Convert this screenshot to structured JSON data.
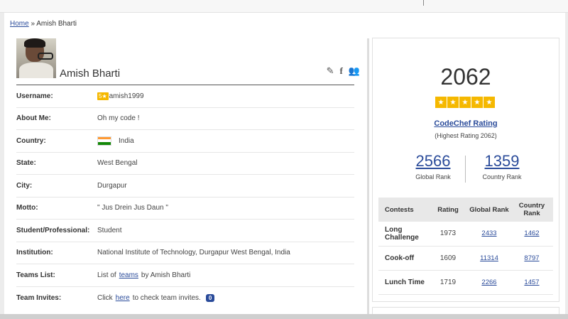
{
  "breadcrumb": {
    "home": "Home",
    "separator": "»",
    "current": "Amish Bharti"
  },
  "profile": {
    "name": "Amish Bharti",
    "actions": [
      {
        "icon": "pencil-icon",
        "glyph": "✎"
      },
      {
        "icon": "facebook-icon",
        "glyph": "f"
      },
      {
        "icon": "users-icon",
        "glyph": "👥"
      }
    ],
    "rows": [
      {
        "label": "Username:",
        "value": "amish1999",
        "badge": "5★"
      },
      {
        "label": "About Me:",
        "value": "Oh my code !"
      },
      {
        "label": "Country:",
        "value": "India"
      },
      {
        "label": "State:",
        "value": "West Bengal"
      },
      {
        "label": "City:",
        "value": "Durgapur"
      },
      {
        "label": "Motto:",
        "value": "\" Jus Drein Jus Daun \""
      },
      {
        "label": "Student/Professional:",
        "value": "Student"
      },
      {
        "label": "Institution:",
        "value": "National Institute of Technology, Durgapur West Bengal, India"
      },
      {
        "label": "Teams List:",
        "prefix": "List of",
        "link": "teams",
        "suffix": "by Amish Bharti"
      },
      {
        "label": "Team Invites:",
        "prefix": "Click",
        "link": "here",
        "suffix": "to check team invites.",
        "count": "0"
      }
    ]
  },
  "rating": {
    "value": "2062",
    "stars": [
      "★",
      "★",
      "★",
      "★",
      "★"
    ],
    "title": "CodeChef Rating",
    "highest": "(Highest Rating 2062)",
    "global_rank": "2566",
    "global_label": "Global Rank",
    "country_rank": "1359",
    "country_label": "Country Rank"
  },
  "contests": {
    "headers": [
      "Contests",
      "Rating",
      "Global Rank",
      "Country Rank"
    ],
    "rows": [
      {
        "name": "Long Challenge",
        "rating": "1973",
        "global": "2433",
        "country": "1462"
      },
      {
        "name": "Cook-off",
        "rating": "1609",
        "global": "11314",
        "country": "8797"
      },
      {
        "name": "Lunch Time",
        "rating": "1719",
        "global": "2266",
        "country": "1457"
      }
    ]
  },
  "colors": {
    "link": "#2a4b9a",
    "star": "#f5b800",
    "flag": [
      "#ff9933",
      "#ffffff",
      "#138808"
    ]
  }
}
